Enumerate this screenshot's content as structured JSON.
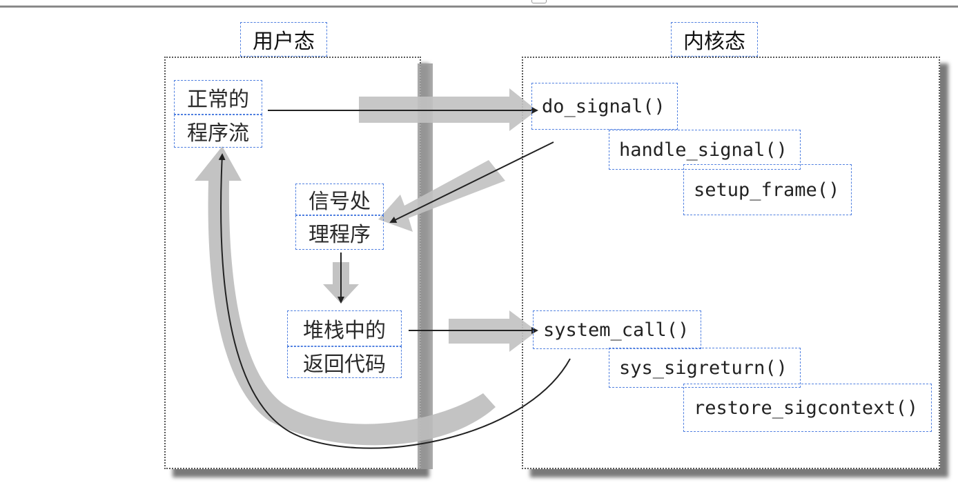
{
  "titles": {
    "user_mode": "用户态",
    "kernel_mode": "内核态"
  },
  "user": {
    "normal_flow_line1": "正常的",
    "normal_flow_line2": "程序流",
    "handler_line1": "信号处",
    "handler_line2": "理程序",
    "stack_code_line1": "堆栈中的",
    "stack_code_line2": "返回代码"
  },
  "kernel": {
    "do_signal": "do_signal()",
    "handle_signal": "handle_signal()",
    "setup_frame": "setup_frame()",
    "system_call": "system_call()",
    "sys_sigreturn": "sys_sigreturn()",
    "restore_sigcontext": "restore_sigcontext()"
  },
  "colors": {
    "label_border": "#4f7fe0",
    "panel_border": "#555555",
    "shadow": "#7a7a7a",
    "broad_arrow": "#bdbdbd",
    "thin_arrow": "#222222"
  }
}
